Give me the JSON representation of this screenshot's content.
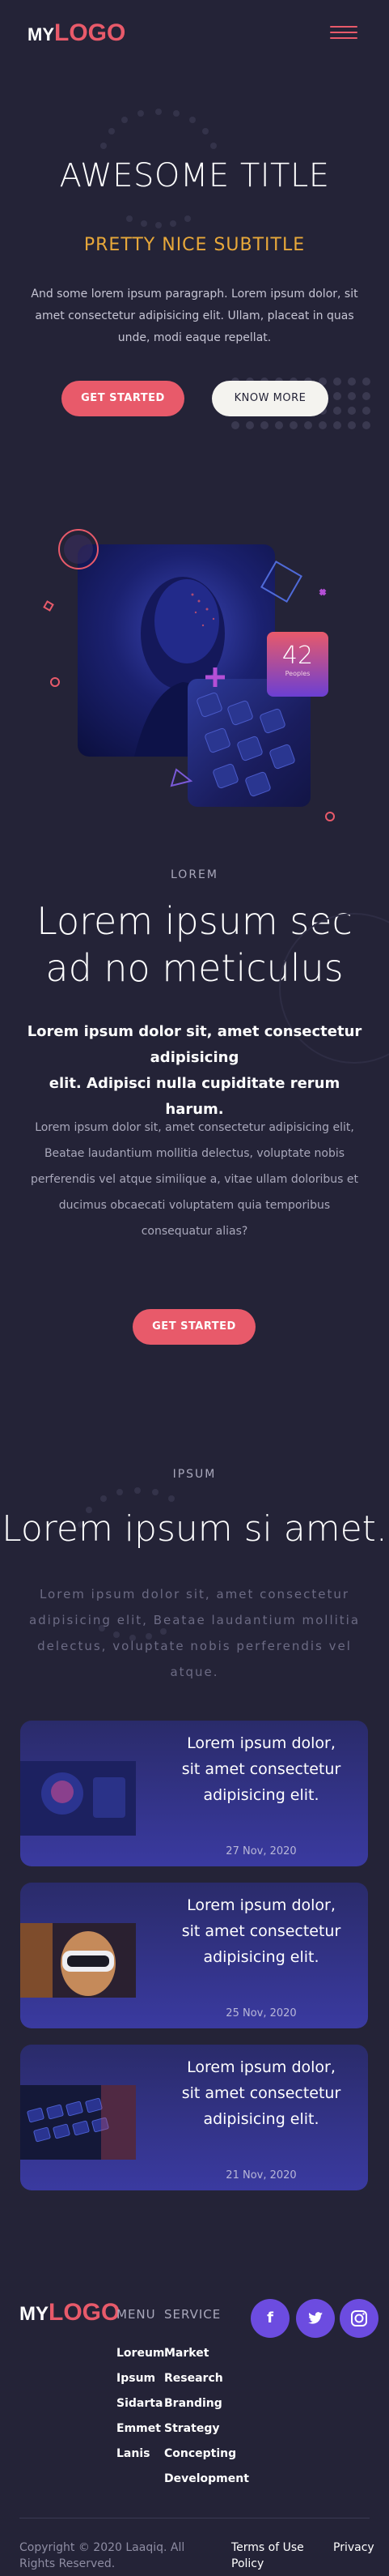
{
  "header": {
    "logo_my": "MY",
    "logo_text": "LOGO"
  },
  "hero": {
    "title": "AWESOME TITLE",
    "subtitle": "PRETTY NICE SUBTITLE",
    "paragraph": "And some lorem ipsum paragraph. Lorem ipsum dolor, sit amet consectetur adipisicing elit. Ullam, placeat in quas unde, modi eaque repellat.",
    "primary_btn": "GET STARTED",
    "secondary_btn": "KNOW MORE"
  },
  "stat": {
    "number": "42",
    "label": "Peoples"
  },
  "section2": {
    "eyebrow": "LOREM",
    "title_line1": "Lorem ipsum sec",
    "title_line2": "ad no meticulus",
    "lead_line1": "Lorem ipsum dolor sit, amet consectetur adipisicing",
    "lead_line2": "elit. Adipisci nulla cupiditate rerum harum.",
    "body": "Lorem ipsum dolor sit, amet consectetur adipisicing elit, Beatae laudantium mollitia delectus, voluptate nobis perferendis vel atque similique a, vitae ullam doloribus et ducimus obcaecati voluptatem quia temporibus consequatur alias?",
    "button": "GET STARTED"
  },
  "section3": {
    "eyebrow": "IPSUM",
    "title": "Lorem ipsum si amet.",
    "body": "Lorem ipsum dolor sit, amet consectetur adipisicing elit, Beatae laudantium mollitia delectus, voluptate nobis perferendis vel atque.",
    "cards": [
      {
        "title": "Lorem ipsum dolor, sit amet consectetur adipisicing elit.",
        "date": "27 Nov, 2020"
      },
      {
        "title": "Lorem ipsum dolor, sit amet consectetur adipisicing elit.",
        "date": "25 Nov, 2020"
      },
      {
        "title": "Lorem ipsum dolor, sit amet consectetur adipisicing elit.",
        "date": "21 Nov, 2020"
      }
    ]
  },
  "footer": {
    "logo_my": "MY",
    "logo_text": "LOGO",
    "menu_heading": "MENU",
    "menu_items": [
      "Loreum",
      "Ipsum",
      "Sidarta",
      "Emmet",
      "Lanis"
    ],
    "service_heading": "SERVICE",
    "service_items": [
      "Market",
      "Research",
      "Branding",
      "Strategy",
      "Concepting",
      "Development"
    ],
    "social": {
      "facebook": "f",
      "twitter": "t",
      "instagram": "ig"
    },
    "copyright": "Copyright © 2020 Laaqiq. All Rights Reserved.",
    "terms": "Terms of Use Policy",
    "privacy": "Privacy"
  },
  "colors": {
    "accent": "#e85a6a",
    "subtitle": "#e8a83a",
    "background": "#242337",
    "social": "#6c4ce0"
  }
}
